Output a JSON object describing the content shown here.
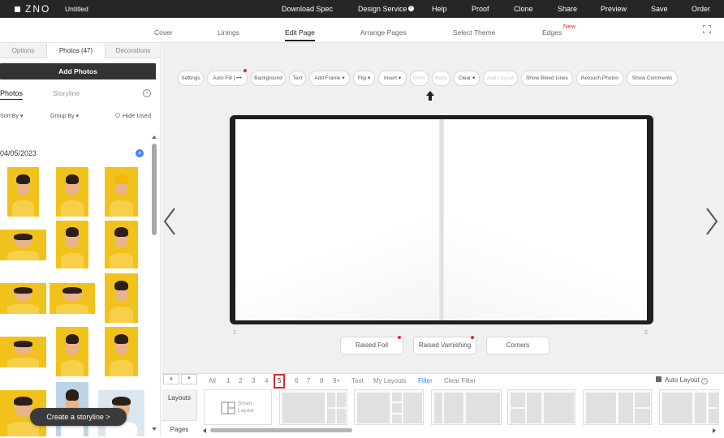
{
  "app": {
    "logo": "ZNO",
    "doc_title": "Untitled"
  },
  "top_menu": [
    "Download Spec",
    "Design Service",
    "Help",
    "Proof",
    "Clone",
    "Share",
    "Preview",
    "Save",
    "Order"
  ],
  "sub_nav": {
    "items": [
      "Cover",
      "Linings",
      "Edit Page",
      "Arrange Pages",
      "Select Theme",
      "Edges"
    ],
    "active": "Edit Page",
    "new_badge": "New"
  },
  "left_panel": {
    "tabs": [
      "Options",
      "Photos (47)",
      "Decorations"
    ],
    "active_tab": "Photos (47)",
    "add_photos": "Add Photos",
    "photos_tab": "Photos",
    "storyline_tab": "Storyline",
    "sort_by": "Sort By",
    "group_by": "Group By",
    "hide_used": "Hide Used",
    "date": "04/05/2023",
    "storyline_button": "Create a storyline >"
  },
  "toolbar": [
    "Settings",
    "Auto Fill | •••",
    "Background",
    "Text",
    "Add Frame",
    "Flip",
    "Insert",
    "Undo",
    "Redo",
    "Clear",
    "Add Layout",
    "Show Bleed Lines",
    "Retouch Photos",
    "Show Comments"
  ],
  "toolbar_disabled": [
    "Undo",
    "Redo",
    "Add Layout"
  ],
  "page_numbers": {
    "left": "1",
    "right": "2"
  },
  "finishes": [
    "Raised Foil",
    "Raised Varnishing",
    "Corners"
  ],
  "bottom": {
    "page_filter": [
      "All",
      "1",
      "2",
      "3",
      "4",
      "5",
      "6",
      "7",
      "8",
      "9+",
      "Text",
      "My Layouts",
      "Filter",
      "Clear Filter"
    ],
    "selected_filter": "5",
    "auto_layout": "Auto Layout",
    "tabs": [
      "Layouts",
      "Pages"
    ],
    "smart_layout": "Smart Layout"
  },
  "colors": {
    "topbar": "#262626",
    "accent_blue": "#3b86f5",
    "alert_red": "#e02a2a",
    "photo_bg": "#f1c21b"
  }
}
